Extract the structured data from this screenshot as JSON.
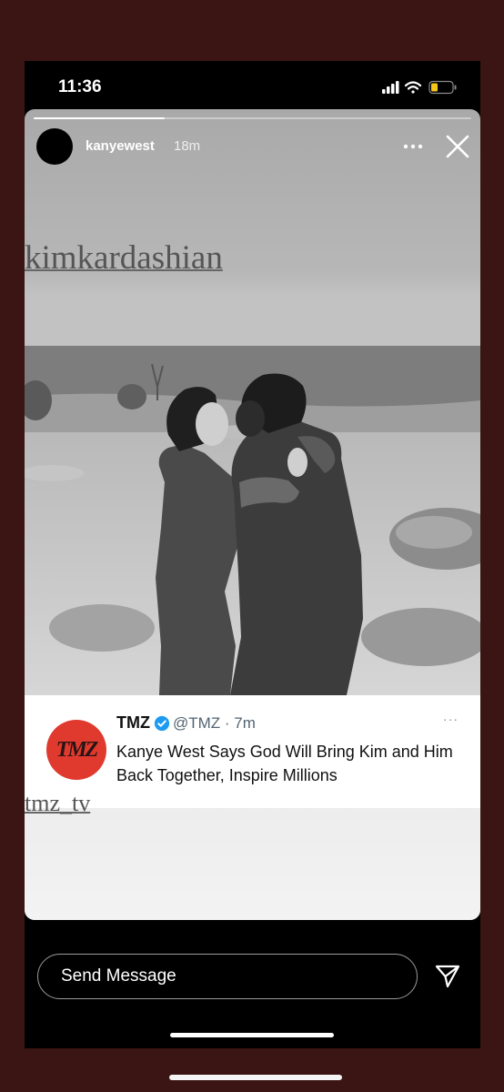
{
  "status_bar": {
    "time": "11:36",
    "battery_color": "#f5c518"
  },
  "story": {
    "username": "kanyewest",
    "posted_ago": "18m",
    "progress": 0.3,
    "mention_1": "kimkardashian",
    "mention_2": "tmz_tv",
    "more_icon": "ellipsis-icon",
    "close_icon": "close-icon"
  },
  "tweet": {
    "logo_text": "TMZ",
    "logo_color": "#e03a2f",
    "name": "TMZ",
    "handle": "@TMZ · 7m",
    "more": "···",
    "text": "Kanye West Says God Will Bring Kim and Him Back Together, Inspire Millions"
  },
  "message": {
    "placeholder": "Send Message",
    "send_icon": "paper-plane-icon"
  }
}
